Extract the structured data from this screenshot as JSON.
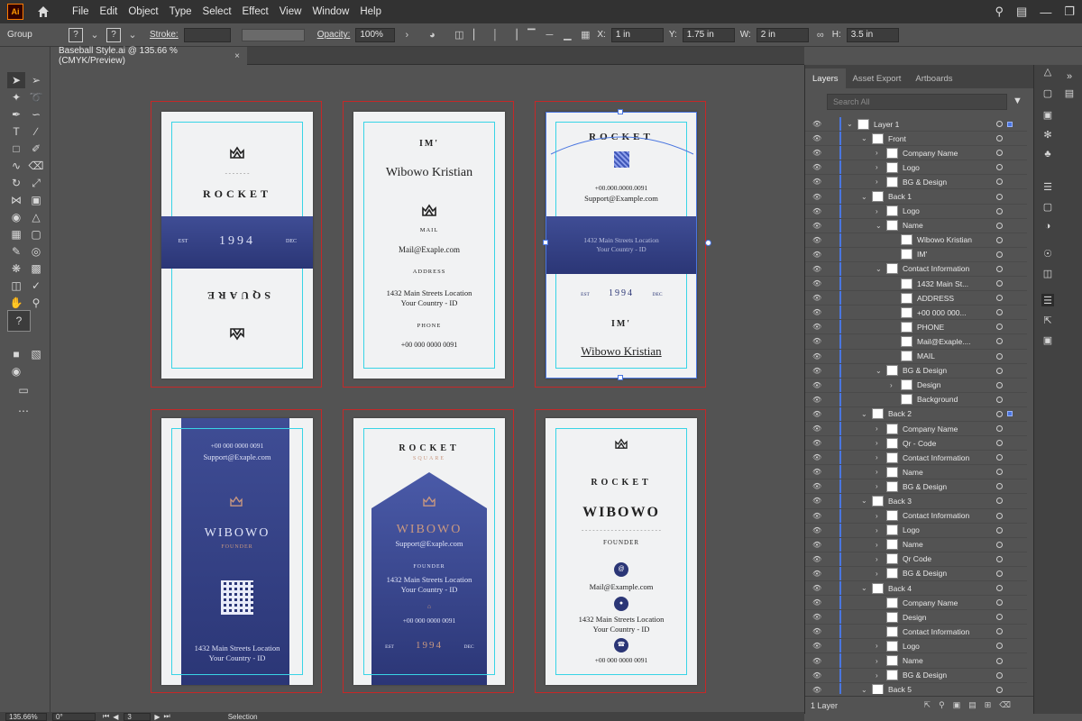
{
  "app": {
    "logo": "Ai"
  },
  "menu": [
    "File",
    "Edit",
    "Object",
    "Type",
    "Select",
    "Effect",
    "View",
    "Window",
    "Help"
  ],
  "control": {
    "selection_type": "Group",
    "fill_value": "?",
    "stroke_swatch": "?",
    "stroke_label": "Stroke:",
    "opacity_label": "Opacity:",
    "opacity": "100%",
    "x_label": "X:",
    "x": "1 in",
    "y_label": "Y:",
    "y": "1.75 in",
    "w_label": "W:",
    "w": "2 in",
    "h_label": "H:",
    "h": "3.5 in"
  },
  "document_tab": {
    "title": "Baseball Style.ai @ 135.66 % (CMYK/Preview)",
    "close": "×"
  },
  "status": {
    "zoom": "135.66%",
    "rotation": "0°",
    "artboard": "3",
    "tool": "Selection"
  },
  "cards": {
    "c1": {
      "brand": "ROCKET",
      "est": "EST",
      "year": "1994",
      "dec": "DEC",
      "sub": "SQUARE"
    },
    "c2": {
      "im": "IM'",
      "name": "Wibowo Kristian",
      "mail_h": "MAIL",
      "mail": "Mail@Exaple.com",
      "addr_h": "ADDRESS",
      "addr1": "1432 Main Streets Location",
      "addr2": "Your Country - ID",
      "phone_h": "PHONE",
      "phone": "+00 000 0000 0091"
    },
    "c3": {
      "brand": "ROCKET",
      "phone": "+00.000.0000.0091",
      "email": "Support@Example.com",
      "addr1": "1432 Main Streets Location",
      "addr2": "Your Country - ID",
      "est": "EST",
      "year": "1994",
      "dec": "DEC",
      "im": "IM'",
      "name": "Wibowo Kristian"
    },
    "c4": {
      "phone": "+00 000 0000 0091",
      "email": "Support@Exaple.com",
      "name": "WIBOWO",
      "role": "FOUNDER",
      "addr1": "1432 Main Streets Location",
      "addr2": "Your Country - ID"
    },
    "c5": {
      "brand": "ROCKET",
      "sub": "SQUARE",
      "name": "WIBOWO",
      "email": "Support@Exaple.com",
      "role": "FOUNDER",
      "addr1": "1432 Main Streets Location",
      "addr2": "Your Country - ID",
      "phone": "+00 000 0000 0091",
      "est": "EST",
      "year": "1994",
      "dec": "DEC"
    },
    "c6": {
      "brand": "ROCKET",
      "name": "WIBOWO",
      "role": "FOUNDER",
      "email": "Mail@Example.com",
      "addr1": "1432 Main Streets Location",
      "addr2": "Your Country - ID",
      "phone": "+00 000 0000 0091"
    }
  },
  "layers_panel": {
    "tabs": [
      "Layers",
      "Asset Export",
      "Artboards"
    ],
    "search_placeholder": "Search All",
    "footer": "1 Layer",
    "rows": [
      {
        "name": "Layer 1",
        "depth": 0,
        "open": true
      },
      {
        "name": "Front",
        "depth": 1,
        "open": true
      },
      {
        "name": "Company Name",
        "depth": 2,
        "open": false
      },
      {
        "name": "Logo",
        "depth": 2,
        "open": false
      },
      {
        "name": "BG & Design",
        "depth": 2,
        "open": false
      },
      {
        "name": "Back 1",
        "depth": 1,
        "open": true
      },
      {
        "name": "Logo",
        "depth": 2,
        "open": false
      },
      {
        "name": "Name",
        "depth": 2,
        "open": true
      },
      {
        "name": "Wibowo Kristian",
        "depth": 3,
        "open": null
      },
      {
        "name": "IM'",
        "depth": 3,
        "open": null
      },
      {
        "name": "Contact Information",
        "depth": 2,
        "open": true
      },
      {
        "name": "1432 Main St...",
        "depth": 3,
        "open": null
      },
      {
        "name": "ADDRESS",
        "depth": 3,
        "open": null
      },
      {
        "name": "+00 000 000...",
        "depth": 3,
        "open": null
      },
      {
        "name": "PHONE",
        "depth": 3,
        "open": null
      },
      {
        "name": "Mail@Exaple....",
        "depth": 3,
        "open": null
      },
      {
        "name": "MAIL",
        "depth": 3,
        "open": null
      },
      {
        "name": "BG & Design",
        "depth": 2,
        "open": true
      },
      {
        "name": "Design",
        "depth": 3,
        "open": false
      },
      {
        "name": "Background",
        "depth": 3,
        "open": null
      },
      {
        "name": "Back 2",
        "depth": 1,
        "open": true
      },
      {
        "name": "Company Name",
        "depth": 2,
        "open": false
      },
      {
        "name": "Qr - Code",
        "depth": 2,
        "open": false
      },
      {
        "name": "Contact Information",
        "depth": 2,
        "open": false
      },
      {
        "name": "Name",
        "depth": 2,
        "open": false
      },
      {
        "name": "BG & Design",
        "depth": 2,
        "open": false
      },
      {
        "name": "Back 3",
        "depth": 1,
        "open": true
      },
      {
        "name": "Contact Information",
        "depth": 2,
        "open": false
      },
      {
        "name": "Logo",
        "depth": 2,
        "open": false
      },
      {
        "name": "Name",
        "depth": 2,
        "open": false
      },
      {
        "name": "Qr Code",
        "depth": 2,
        "open": false
      },
      {
        "name": "BG & Design",
        "depth": 2,
        "open": false
      },
      {
        "name": "Back 4",
        "depth": 1,
        "open": true
      },
      {
        "name": "Company Name",
        "depth": 2,
        "open": null
      },
      {
        "name": "Design",
        "depth": 2,
        "open": null
      },
      {
        "name": "Contact Information",
        "depth": 2,
        "open": null
      },
      {
        "name": "Logo",
        "depth": 2,
        "open": false
      },
      {
        "name": "Name",
        "depth": 2,
        "open": false
      },
      {
        "name": "BG & Design",
        "depth": 2,
        "open": false
      },
      {
        "name": "Back 5",
        "depth": 1,
        "open": true
      }
    ]
  }
}
